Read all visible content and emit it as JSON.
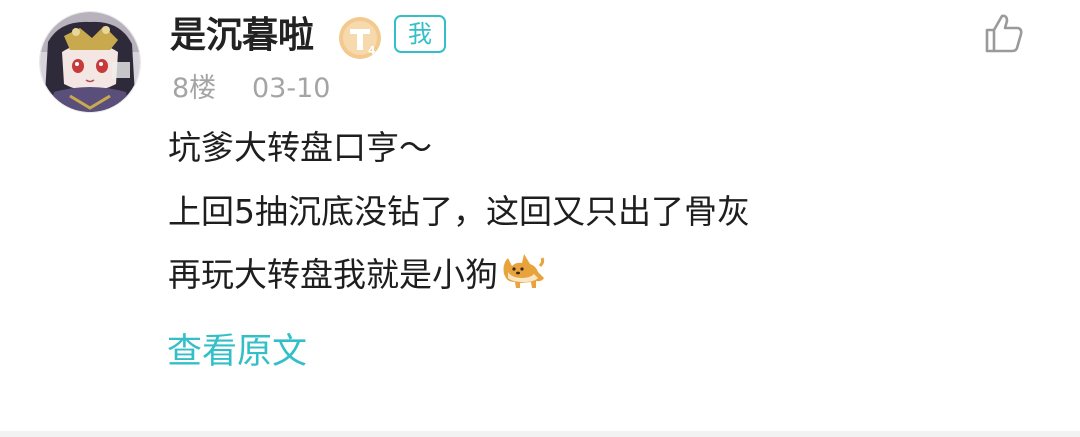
{
  "comment": {
    "username": "是沉暮啦",
    "level_badge_icon": "tieba-level-badge-icon",
    "self_tag": "我",
    "floor": "8楼",
    "date": "03-10",
    "like_icon": "thumbs-up-icon",
    "lines": [
      "坑爹大转盘口亨～",
      "上回5抽沉底没钻了，这回又只出了骨灰",
      "再玩大转盘我就是小狗"
    ],
    "trailing_emoji": "dog-emoji-icon",
    "view_original_label": "查看原文"
  },
  "colors": {
    "accent": "#33bfc8",
    "username": "#222222",
    "meta_text": "#a4a4a4",
    "body_text": "#1e1e1e",
    "divider": "#f2f2f2"
  }
}
